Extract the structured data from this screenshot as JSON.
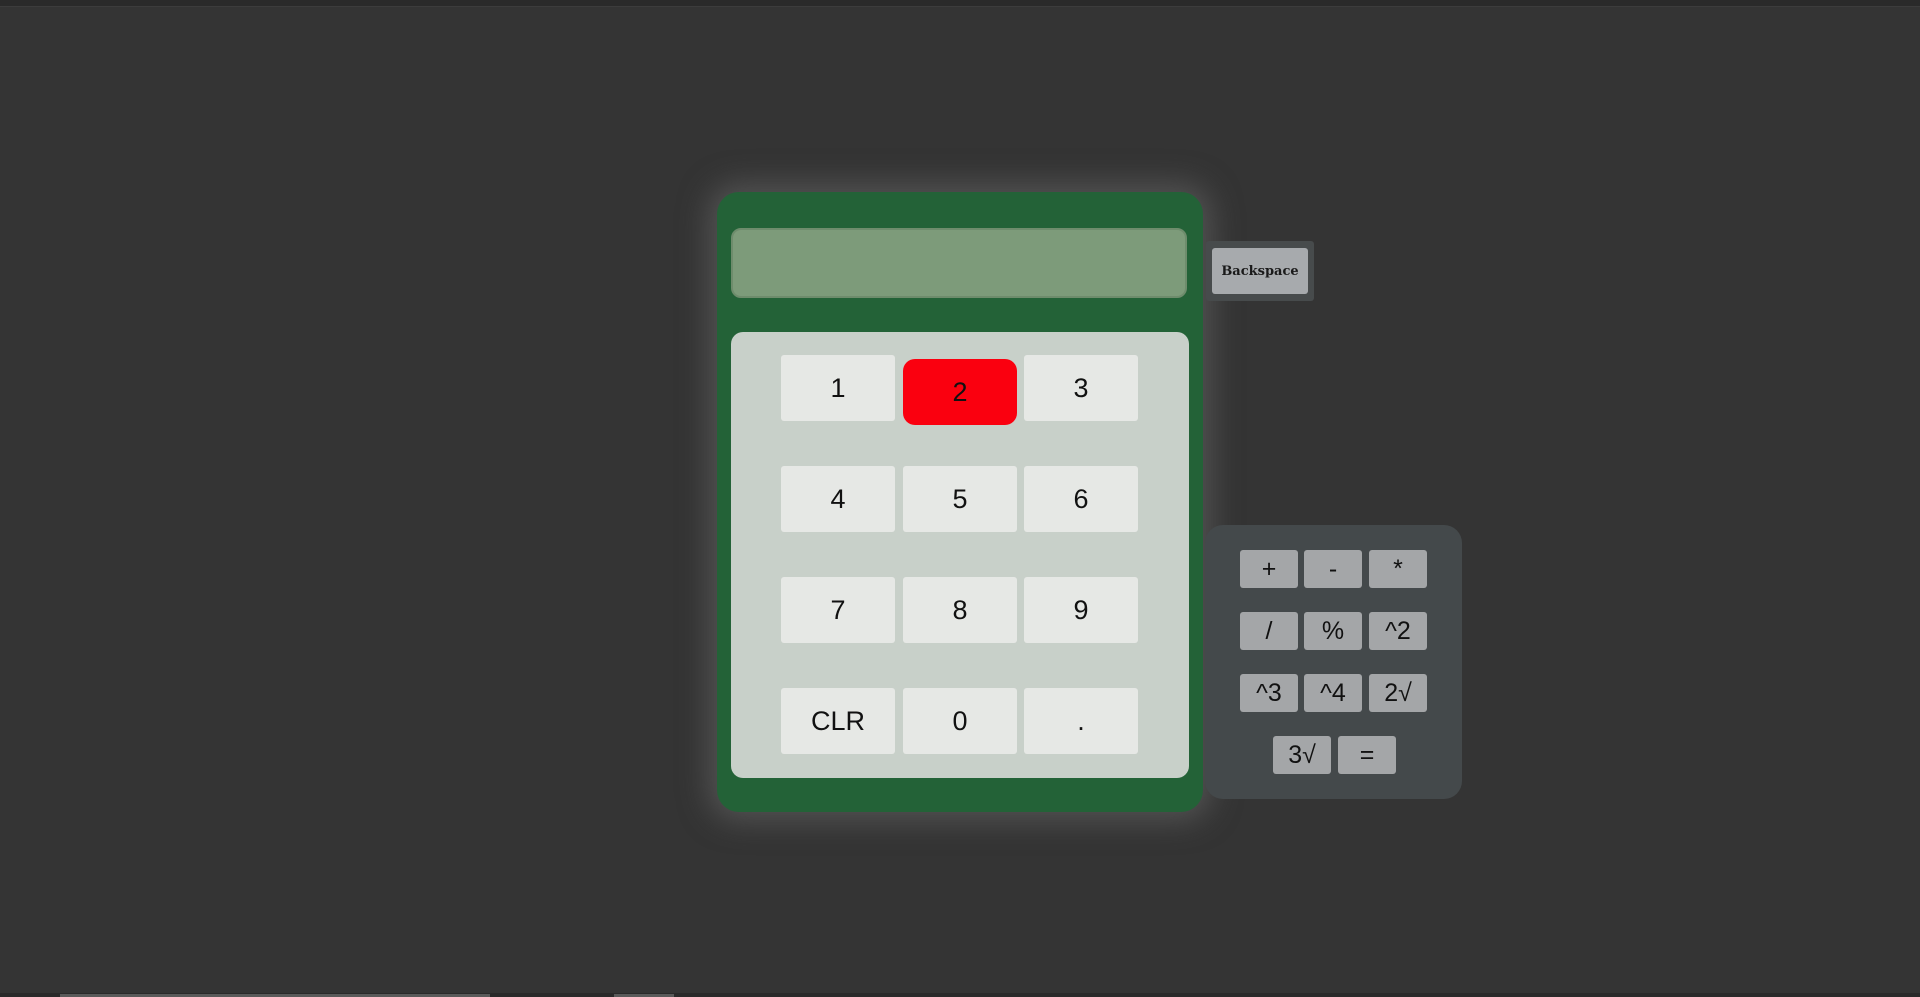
{
  "calculator": {
    "display": {
      "value": ""
    },
    "keys": [
      {
        "label": "1",
        "active": false
      },
      {
        "label": "2",
        "active": true
      },
      {
        "label": "3",
        "active": false
      },
      {
        "label": "4",
        "active": false
      },
      {
        "label": "5",
        "active": false
      },
      {
        "label": "6",
        "active": false
      },
      {
        "label": "7",
        "active": false
      },
      {
        "label": "8",
        "active": false
      },
      {
        "label": "9",
        "active": false
      },
      {
        "label": "CLR",
        "active": false
      },
      {
        "label": "0",
        "active": false
      },
      {
        "label": ".",
        "active": false
      }
    ],
    "backspace_label": "Backspace",
    "operators": [
      "+",
      "-",
      "*",
      "/",
      "%",
      "^2",
      "^3",
      "^4",
      "2√",
      "3√",
      "="
    ]
  },
  "colors": {
    "page_background": "#343434",
    "calculator_body": "#236237",
    "display": "#7d9b7a",
    "keypad": "#c8d0c9",
    "key": "#e6e8e5",
    "key_active": "#fa000f",
    "operator_panel": "#44494b",
    "operator_key": "#a4a6a8"
  }
}
